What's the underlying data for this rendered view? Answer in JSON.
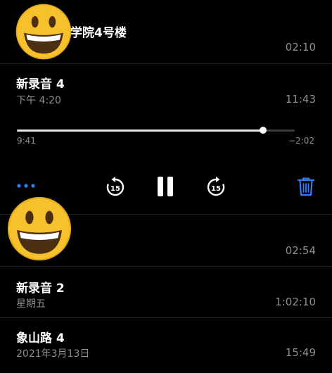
{
  "recordings": [
    {
      "title": "学院4号楼",
      "date": "",
      "duration": "02:10"
    },
    {
      "title": "新录音 4",
      "date": "下午 4:20",
      "duration": "11:43"
    },
    {
      "title": "",
      "date": "",
      "duration": "02:54"
    },
    {
      "title": "新录音 2",
      "date": "星期五",
      "duration": "1:02:10"
    },
    {
      "title": "象山路 4",
      "date": "2021年3月13日",
      "duration": "15:49"
    }
  ],
  "player": {
    "elapsed": "9:41",
    "remaining": "−2:02",
    "progress": 0.885,
    "skip_back_label": "15",
    "skip_forward_label": "15"
  },
  "icons": {
    "more": "more-dots-icon",
    "skip_back": "skip-back-15-icon",
    "pause": "pause-icon",
    "skip_forward": "skip-forward-15-icon",
    "delete": "trash-icon",
    "sticker": "grinning-face-emoji"
  },
  "colors": {
    "accent": "#2f7cf6",
    "secondary_text": "#8e8e93"
  }
}
